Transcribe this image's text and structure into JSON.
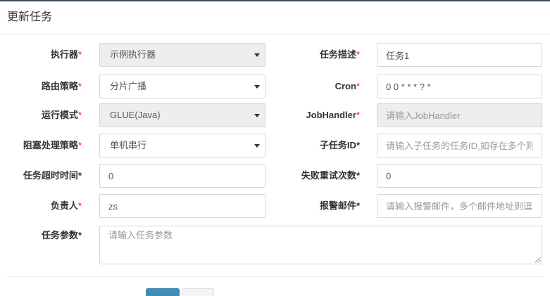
{
  "modal": {
    "title": "更新任务"
  },
  "form": {
    "executor": {
      "label": "执行器",
      "required_mark": "*",
      "mark_red": true,
      "value": "示例执行器",
      "disabled": true
    },
    "job_desc": {
      "label": "任务描述",
      "required_mark": "*",
      "mark_red": true,
      "value": "任务1"
    },
    "route_strategy": {
      "label": "路由策略",
      "required_mark": "*",
      "mark_red": true,
      "value": "分片广播",
      "disabled": false
    },
    "cron": {
      "label": "Cron",
      "required_mark": "*",
      "mark_red": true,
      "value": "0 0 * * * ? *"
    },
    "glue_type": {
      "label": "运行模式",
      "required_mark": "*",
      "mark_red": true,
      "value": "GLUE(Java)",
      "disabled": true
    },
    "job_handler": {
      "label": "JobHandler",
      "required_mark": "*",
      "mark_red": true,
      "placeholder": "请输入JobHandler",
      "disabled": true
    },
    "block_strategy": {
      "label": "阻塞处理策略",
      "required_mark": "*",
      "mark_red": true,
      "value": "单机串行",
      "disabled": false
    },
    "child_job_id": {
      "label": "子任务ID",
      "required_mark": "*",
      "mark_red": false,
      "placeholder": "请输入子任务的任务ID,如存在多个则逗"
    },
    "timeout": {
      "label": "任务超时时间",
      "required_mark": "*",
      "mark_red": false,
      "value": "0"
    },
    "fail_retry": {
      "label": "失败重试次数",
      "required_mark": "*",
      "mark_red": false,
      "value": "0"
    },
    "author": {
      "label": "负责人",
      "required_mark": "*",
      "mark_red": true,
      "value": "zs"
    },
    "alarm_email": {
      "label": "报警邮件",
      "required_mark": "*",
      "mark_red": false,
      "placeholder": "请输入报警邮件，多个邮件地址则逗号分"
    },
    "executor_param": {
      "label": "任务参数",
      "required_mark": "*",
      "mark_red": false,
      "placeholder": "请输入任务参数"
    }
  },
  "icons": {
    "select_caret": "caret-down-icon",
    "textarea_resize": "resize-handle-icon"
  },
  "colors": {
    "top_border": "#3c4b59",
    "required_mark": "#ff0000",
    "primary_button": "#3c8dbc",
    "disabled_bg": "#eeeeee",
    "input_border": "#d2d6de"
  }
}
